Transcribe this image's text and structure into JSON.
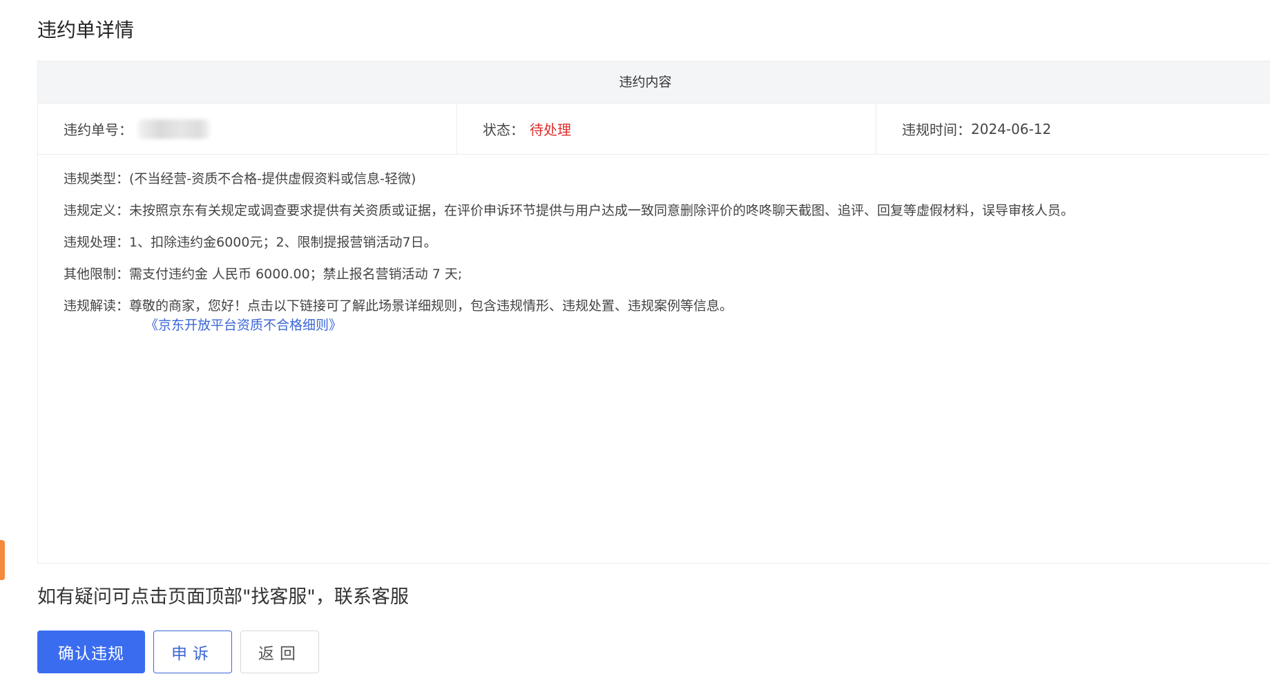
{
  "page": {
    "title": "违约单详情"
  },
  "panel": {
    "header": "违约内容",
    "order_no_label": "违约单号：",
    "status_label": "状态：",
    "status_value": "待处理",
    "time_label": "违规时间：",
    "time_value": "2024-06-12"
  },
  "details": {
    "type_label": "违规类型：",
    "type_value": "(不当经营-资质不合格-提供虚假资料或信息-轻微)",
    "definition_label": "违规定义：",
    "definition_value": "未按照京东有关规定或调查要求提供有关资质或证据，在评价申诉环节提供与用户达成一致同意删除评价的咚咚聊天截图、追评、回复等虚假材料，误导审核人员。",
    "handling_label": "违规处理：",
    "handling_value": "1、扣除违约金6000元；2、限制提报营销活动7日。",
    "other_label": "其他限制：",
    "other_value": "需支付违约金 人民币 6000.00；禁止报名营销活动 7 天;",
    "interpret_label": "违规解读：",
    "interpret_value": "尊敬的商家，您好！点击以下链接可了解此场景详细规则，包含违规情形、违规处置、违规案例等信息。",
    "rule_link": "《京东开放平台资质不合格细则》"
  },
  "notice": "如有疑问可点击页面顶部\"找客服\"，联系客服",
  "buttons": {
    "confirm": "确认违规",
    "appeal": "申诉",
    "back": "返回"
  },
  "colors": {
    "primary": "#3a6cf0",
    "status": "#e02c2c",
    "link": "#3a66d6",
    "side_tab": "#f58a3c"
  }
}
